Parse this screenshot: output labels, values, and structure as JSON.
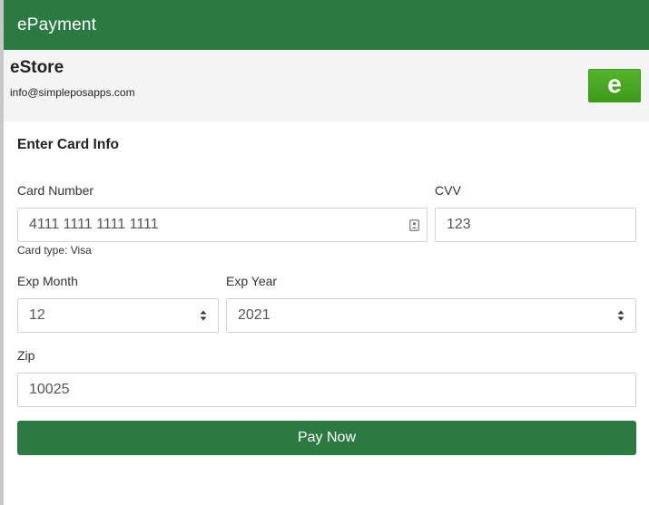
{
  "app": {
    "title": "ePayment"
  },
  "store": {
    "name": "eStore",
    "email": "info@simpleposapps.com",
    "logo_letter": "e"
  },
  "form": {
    "heading": "Enter Card Info",
    "card_number": {
      "label": "Card Number",
      "value": "4111 1111 1111 1111",
      "card_type": "Card type: Visa"
    },
    "cvv": {
      "label": "CVV",
      "value": "123"
    },
    "exp_month": {
      "label": "Exp Month",
      "value": "12"
    },
    "exp_year": {
      "label": "Exp Year",
      "value": "2021"
    },
    "zip": {
      "label": "Zip",
      "value": "10025"
    },
    "submit_label": "Pay Now"
  },
  "colors": {
    "primary": "#2b7a41",
    "header_bg": "#f4f4f4",
    "logo_green": "#4caa24"
  },
  "icons": {
    "card_field": "contact-card-icon",
    "select": "sort-arrows-icon"
  }
}
